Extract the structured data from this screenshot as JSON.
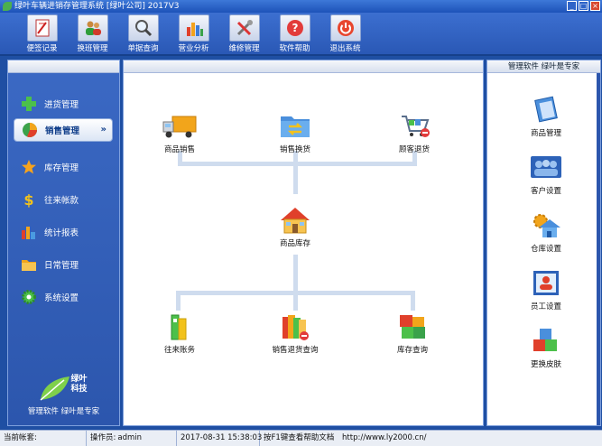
{
  "window": {
    "title": "绿叶车辆进销存管理系统 [绿叶公司] 2017V3",
    "minimize": "_",
    "maximize": "□",
    "close": "×"
  },
  "toolbar": [
    {
      "label": "便签记录",
      "icon": "notepad-icon"
    },
    {
      "label": "换班管理",
      "icon": "users-icon"
    },
    {
      "label": "单据查询",
      "icon": "magnifier-icon"
    },
    {
      "label": "营业分析",
      "icon": "bar-chart-icon"
    },
    {
      "label": "维修管理",
      "icon": "tools-icon"
    },
    {
      "label": "软件帮助",
      "icon": "help-icon"
    },
    {
      "label": "退出系统",
      "icon": "power-icon"
    }
  ],
  "sidebar": {
    "items": [
      {
        "label": "进货管理",
        "icon": "plus-icon"
      },
      {
        "label": "销售管理",
        "icon": "pie-chart-icon",
        "active": true,
        "chevron": "»"
      },
      {
        "label": "库存管理",
        "icon": "star-icon"
      },
      {
        "label": "往来帐款",
        "icon": "dollar-icon"
      },
      {
        "label": "统计报表",
        "icon": "column-chart-icon"
      },
      {
        "label": "日常管理",
        "icon": "folder-icon"
      },
      {
        "label": "系统设置",
        "icon": "gear-icon"
      }
    ],
    "brand_name_line1": "绿叶",
    "brand_name_line2": "科技",
    "slogan": "管理软件 绿叶是专家"
  },
  "flow": {
    "sales": "商品销售",
    "exchange": "销售换货",
    "customer_return": "顾客退货",
    "inventory": "商品库存",
    "accounts": "往来账务",
    "return_query": "销售退货查询",
    "stock_query": "库存查询"
  },
  "rightpanel": {
    "header": "管理软件 绿叶是专家",
    "items": [
      {
        "label": "商品管理",
        "icon": "ledger-icon"
      },
      {
        "label": "客户设置",
        "icon": "customers-icon"
      },
      {
        "label": "仓库设置",
        "icon": "warehouse-icon"
      },
      {
        "label": "员工设置",
        "icon": "employee-icon"
      },
      {
        "label": "更换皮肤",
        "icon": "cubes-icon"
      }
    ]
  },
  "status": {
    "account_label": "当前帐套:",
    "account_value": "",
    "operator_label": "操作员:",
    "operator_value": "admin",
    "datetime": "2017-08-31 15:38:03",
    "help_hint": "按F1键查看帮助文档",
    "url": "http://www.ly2000.cn/"
  },
  "colors": {
    "frame_blue": "#1f4fa3",
    "panel_blue": "#2c56ad",
    "connector": "#cfdcee"
  }
}
